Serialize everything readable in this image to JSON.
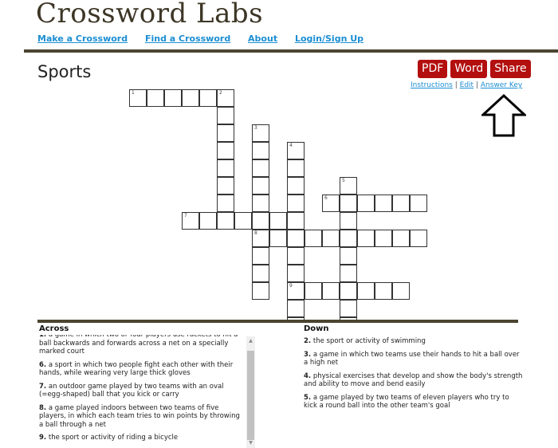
{
  "site": {
    "logo": "Crossword Labs",
    "nav": [
      "Make a Crossword",
      "Find a Crossword",
      "About",
      "Login/Sign Up"
    ]
  },
  "puzzle": {
    "title": "Sports",
    "buttons": [
      "PDF",
      "Word",
      "Share"
    ],
    "links": [
      "Instructions",
      "Edit",
      "Answer Key"
    ],
    "separator": "|",
    "accent_color": "#b30f0f",
    "link_color": "#1b8ed3",
    "words": [
      {
        "number": 1,
        "direction": "across",
        "row": 0,
        "col": 0,
        "length": 6
      },
      {
        "number": 2,
        "direction": "down",
        "row": 0,
        "col": 5,
        "length": 8
      },
      {
        "number": 3,
        "direction": "down",
        "row": 2,
        "col": 7,
        "length": 10
      },
      {
        "number": 4,
        "direction": "down",
        "row": 3,
        "col": 9,
        "length": 11
      },
      {
        "number": 5,
        "direction": "down",
        "row": 5,
        "col": 12,
        "length": 9
      },
      {
        "number": 6,
        "direction": "across",
        "row": 6,
        "col": 11,
        "length": 6
      },
      {
        "number": 7,
        "direction": "across",
        "row": 7,
        "col": 3,
        "length": 6
      },
      {
        "number": 8,
        "direction": "across",
        "row": 8,
        "col": 7,
        "length": 10
      },
      {
        "number": 9,
        "direction": "across",
        "row": 11,
        "col": 9,
        "length": 7
      }
    ]
  },
  "clues": {
    "across_heading": "Across",
    "down_heading": "Down",
    "across": [
      {
        "num": "1.",
        "text": "a game in which two or four players use rackets to hit a ball backwards and forwards across a net on a specially marked court"
      },
      {
        "num": "6.",
        "text": "a sport in which two people fight each other with their hands, while wearing very large thick gloves"
      },
      {
        "num": "7.",
        "text": "an outdoor game played by two teams with an oval (=egg-shaped) ball that you kick or carry"
      },
      {
        "num": "8.",
        "text": "a game played indoors between two teams of five players, in which each team tries to win points by throwing a ball through a net"
      },
      {
        "num": "9.",
        "text": "the sport or activity of riding a bicycle"
      }
    ],
    "down": [
      {
        "num": "2.",
        "text": "the sport or activity of swimming"
      },
      {
        "num": "3.",
        "text": "a game in which two teams use their hands to hit a ball over a high net"
      },
      {
        "num": "4.",
        "text": "physical exercises that develop and show the body's strength and ability to move and bend easily"
      },
      {
        "num": "5.",
        "text": "a game played by two teams of eleven players who try to kick a round ball into the other team's goal"
      }
    ]
  }
}
